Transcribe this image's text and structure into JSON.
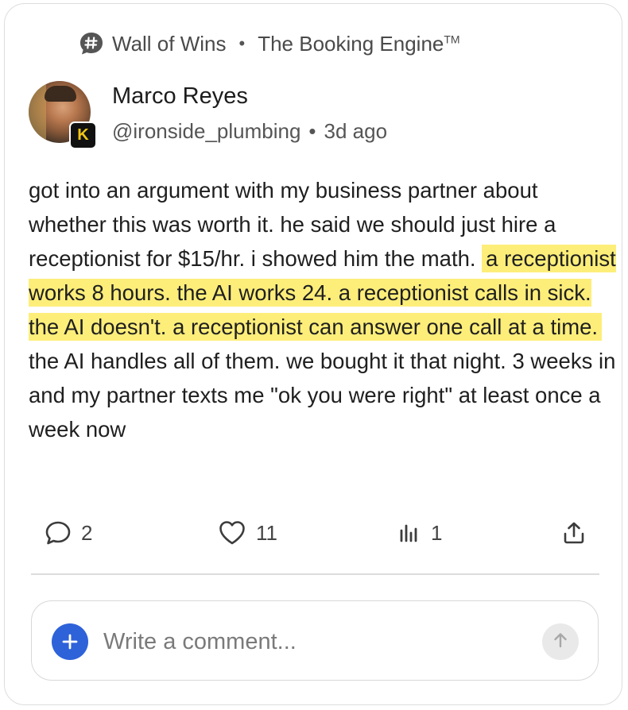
{
  "header": {
    "community": "Wall of Wins",
    "separator": "•",
    "product": "The Booking Engine",
    "trademark": "TM",
    "community_icon": "hashtag-icon"
  },
  "post": {
    "author": {
      "name": "Marco Reyes",
      "handle": "@ironside_plumbing",
      "separator": "•",
      "time": "3d ago",
      "badge_letter": "K",
      "badge_color": "#f3c614"
    },
    "body": {
      "part1": "got into an argument with my business partner about whether this was worth it. he said we should just hire a receptionist for $15/hr. i showed him the math.",
      "highlight": "a receptionist works 8 hours. the AI works 24. a receptionist calls in sick. the AI doesn't. a receptionist can answer one call at a time.",
      "part2": "the AI handles all of them. we bought it that night. 3 weeks in and my partner texts me \"ok you were right\" at least once a week now"
    },
    "highlight_color": "#fdee7a",
    "actions": {
      "comments": {
        "icon": "comment-icon",
        "count": "2"
      },
      "likes": {
        "icon": "heart-icon",
        "count": "11"
      },
      "views": {
        "icon": "bar-chart-icon",
        "count": "1"
      },
      "share": {
        "icon": "share-icon"
      }
    }
  },
  "comment_box": {
    "placeholder": "Write a comment...",
    "add_icon": "plus-icon",
    "send_icon": "arrow-up-icon",
    "accent": "#2e62d9"
  }
}
